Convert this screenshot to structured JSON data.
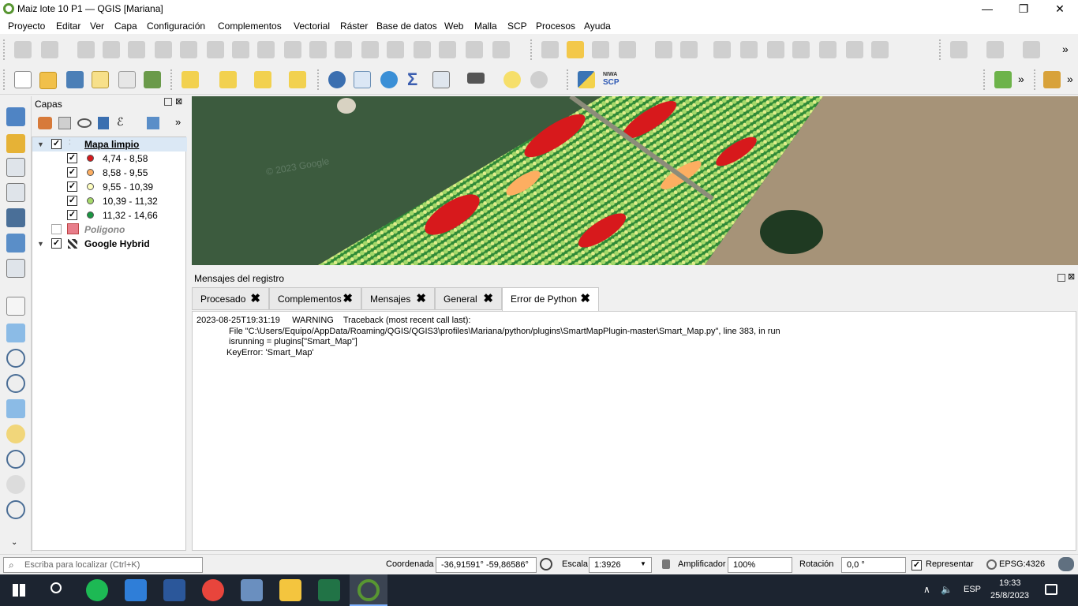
{
  "window": {
    "title": "Maiz lote 10 P1 — QGIS [Mariana]",
    "minimize": "—",
    "maximize": "❐",
    "close": "✕"
  },
  "menu": [
    "Proyecto",
    "Editar",
    "Ver",
    "Capa",
    "Configuración",
    "Complementos",
    "Vectorial",
    "Ráster",
    "Base de datos",
    "Web",
    "Malla",
    "SCP",
    "Procesos",
    "Ayuda"
  ],
  "toolbar": {
    "scp_label_top": "NIWA",
    "scp_label_bottom": "SCP",
    "overflow": "»"
  },
  "layers_panel": {
    "title": "Capas",
    "overflow": "»",
    "layers": [
      {
        "name": "Mapa limpio",
        "checked": true
      },
      {
        "name": "Poligono",
        "checked": false
      },
      {
        "name": "Google Hybrid",
        "checked": true
      }
    ],
    "classes": [
      {
        "label": "4,74 - 8,58",
        "color": "#d7191c"
      },
      {
        "label": "8,58 - 9,55",
        "color": "#fdae61"
      },
      {
        "label": "9,55 - 10,39",
        "color": "#ffffc0"
      },
      {
        "label": "10,39 - 11,32",
        "color": "#a6d96a"
      },
      {
        "label": "11,32 - 14,66",
        "color": "#1a9641"
      }
    ],
    "poligono_color": "#e87d8a"
  },
  "map": {
    "watermark": "© 2023 Google"
  },
  "log_panel": {
    "title": "Mensajes del registro",
    "tabs": [
      "Procesado",
      "Complementos",
      "Mensajes",
      "General",
      "Error de Python"
    ],
    "active_tab": "Error de Python",
    "lines": [
      "2023-08-25T19:31:19     WARNING    Traceback (most recent call last):",
      "File \"C:\\Users/Equipo/AppData/Roaming/QGIS/QGIS3\\profiles\\Mariana/python/plugins\\SmartMapPlugin-master\\Smart_Map.py\", line 383, in run",
      "isrunning = plugins[\"Smart_Map\"]",
      "KeyError: 'Smart_Map'"
    ]
  },
  "statusbar": {
    "locator_placeholder": "Escriba para localizar (Ctrl+K)",
    "coord_label": "Coordenada",
    "coord_value": "-36,91591° -59,86586°",
    "scale_label": "Escala",
    "scale_value": "1:3926",
    "magnifier_label": "Amplificador",
    "magnifier_value": "100%",
    "rotation_label": "Rotación",
    "rotation_value": "0,0 °",
    "render_label": "Representar",
    "crs": "EPSG:4326"
  },
  "taskbar": {
    "language": "ESP",
    "time": "19:33",
    "date": "25/8/2023"
  }
}
